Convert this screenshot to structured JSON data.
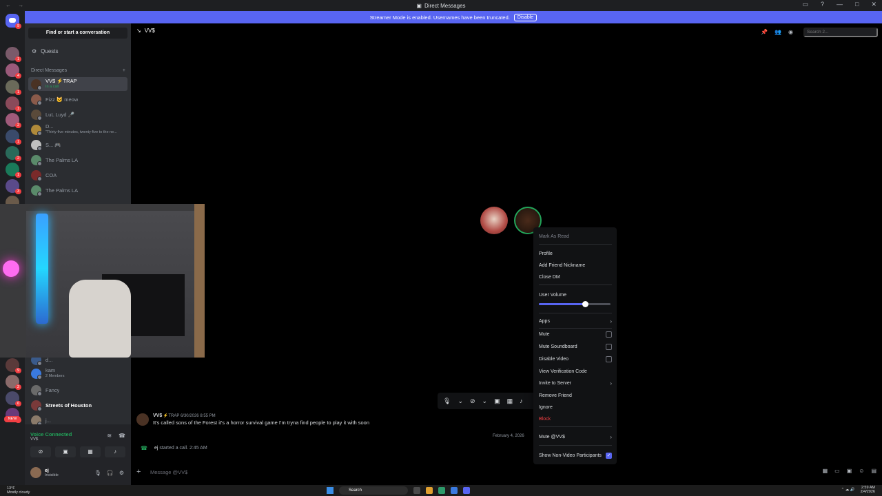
{
  "window": {
    "title": "Direct Messages",
    "nav": "← →"
  },
  "banner": {
    "text": "Streamer Mode is enabled. Usernames have been truncated.",
    "button": "Disable"
  },
  "servers": {
    "badges": [
      "9",
      "1",
      "4",
      "1",
      "1",
      "2",
      "1",
      "2",
      "1",
      "3",
      "1",
      "9",
      "2",
      "6",
      "1",
      "17",
      "$33"
    ],
    "new_label": "NEW"
  },
  "sidebar": {
    "find_label": "Find or start a conversation",
    "quests_label": "Quests",
    "dm_header": "Direct Messages",
    "dm_header_add": "+",
    "dms": [
      {
        "name": "VV$ ⚡TRAP",
        "sub": "In a call"
      },
      {
        "name": "Fizz 🐱 meow",
        "sub": ""
      },
      {
        "name": "LuL Luyd 🎤",
        "sub": ""
      },
      {
        "name": "D...",
        "sub": "\"Thirty-five minutes, twenty-five to the ne..."
      },
      {
        "name": "S... 🎮",
        "sub": ""
      },
      {
        "name": "The Palms LA",
        "sub": ""
      },
      {
        "name": "COA",
        "sub": ""
      },
      {
        "name": "The Palms LA",
        "sub": ""
      },
      {
        "name": "d...",
        "sub": ""
      },
      {
        "name": "kam",
        "sub": "2 Members"
      },
      {
        "name": "Fancy",
        "sub": ""
      },
      {
        "name": "Streets of Houston",
        "sub": ""
      },
      {
        "name": "j...",
        "sub": ""
      }
    ]
  },
  "voice": {
    "title": "Voice Connected",
    "channel": "VV$"
  },
  "user": {
    "name": "ej",
    "status": "Invisible"
  },
  "channel": {
    "name": "VV$",
    "search_placeholder": "Search 2..."
  },
  "messages": {
    "m1_author": "VV$",
    "m1_tag": "⚡TRAP",
    "m1_time": "6/30/2026 8:55 PM",
    "m1_body": "It's called sons of the Forest it's a horror survival game I'm tryna find people to play it with soon",
    "date_divider": "February 4, 2026",
    "call_user": "ej",
    "call_text": "started a call.",
    "call_time": "2:45 AM"
  },
  "composer": {
    "placeholder": "Message @VV$"
  },
  "context_menu": {
    "mark_as_read": "Mark As Read",
    "profile": "Profile",
    "add_friend_nickname": "Add Friend Nickname",
    "close_dm": "Close DM",
    "user_volume": "User Volume",
    "user_volume_level": 0.64,
    "apps": "Apps",
    "mute": "Mute",
    "mute_soundboard": "Mute Soundboard",
    "disable_video": "Disable Video",
    "view_verification_code": "View Verification Code",
    "invite_to_server": "Invite to Server",
    "remove_friend": "Remove Friend",
    "ignore": "Ignore",
    "block": "Block",
    "mute_user": "Mute @VV$",
    "show_non_video": "Show Non-Video Participants",
    "show_non_video_checked": true
  },
  "taskbar": {
    "temp": "13°F",
    "weather": "Mostly cloudy",
    "search": "Search",
    "time": "2:59 AM",
    "date": "2/4/2026"
  },
  "colors": {
    "accent": "#5865f2",
    "online": "#23a55a",
    "danger": "#f23f43"
  }
}
